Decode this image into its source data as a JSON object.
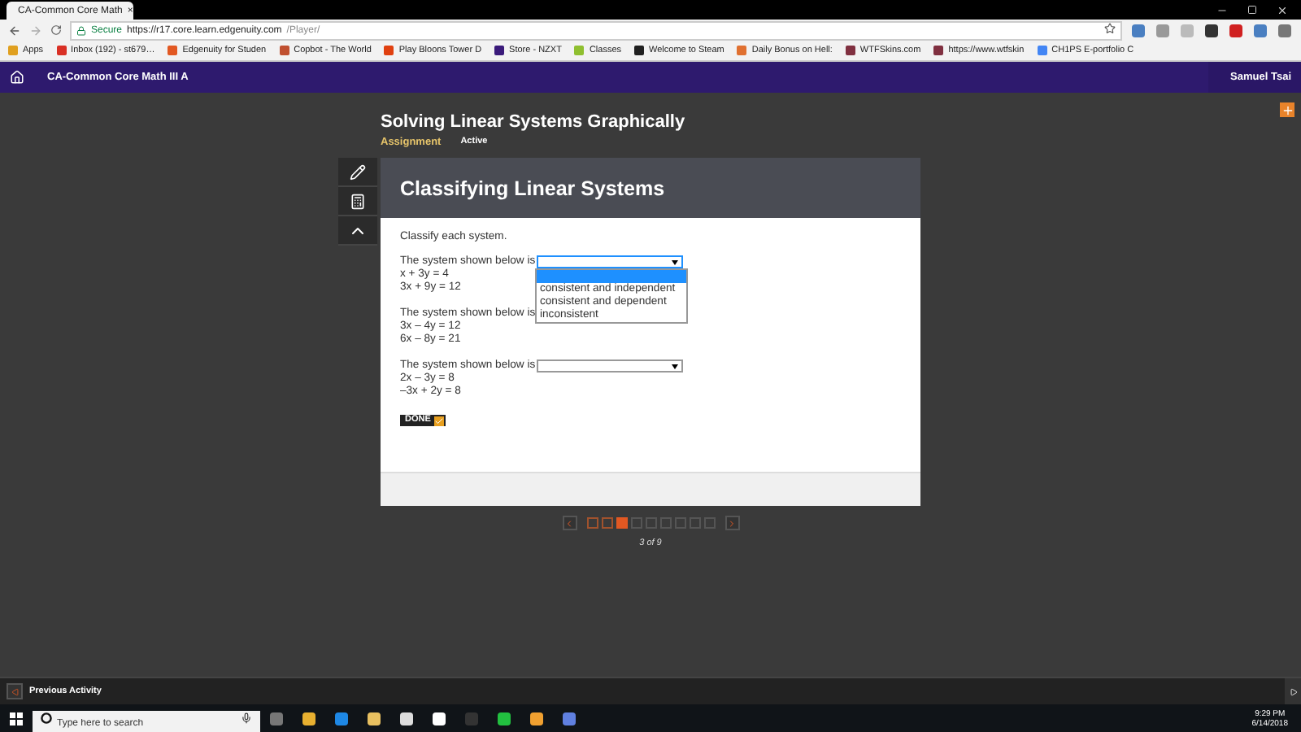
{
  "browser": {
    "tab_title": "CA-Common Core Math",
    "tab_close": "×",
    "secure_label": "Secure",
    "url_host": "https://r17.core.learn.edgenuity.com",
    "url_path": "/Player/",
    "bookmarks": [
      {
        "label": "Apps",
        "color": "#e0a020"
      },
      {
        "label": "Inbox (192) - st679…",
        "color": "#d93025"
      },
      {
        "label": "Edgenuity for Studen",
        "color": "#e25822"
      },
      {
        "label": "Copbot - The World",
        "color": "#c05030"
      },
      {
        "label": "Play Bloons Tower D",
        "color": "#e04010"
      },
      {
        "label": "Store - NZXT",
        "color": "#3a1a7a"
      },
      {
        "label": "Classes",
        "color": "#8fbf30"
      },
      {
        "label": "Welcome to Steam",
        "color": "#202020"
      },
      {
        "label": "Daily Bonus on Hell:",
        "color": "#e07030"
      },
      {
        "label": "WTFSkins.com",
        "color": "#803040"
      },
      {
        "label": "https://www.wtfskin",
        "color": "#803040"
      },
      {
        "label": "CH1PS E-portfolio C",
        "color": "#4285f4"
      }
    ]
  },
  "course_bar": {
    "title": "CA-Common Core Math III A",
    "user": "Samuel Tsai"
  },
  "lesson": {
    "title": "Solving Linear Systems Graphically",
    "tag": "Assignment",
    "status": "Active"
  },
  "activity": {
    "title": "Classifying Linear Systems",
    "instruction": "Classify each system.",
    "questions": [
      {
        "prompt": "The system shown below is",
        "equations": [
          "x + 3y = 4",
          "3x + 9y = 12"
        ],
        "expanded": true,
        "options": [
          {
            "selected": true
          },
          {
            "label": "consistent and independent",
            "selected": false
          },
          {
            "label": "consistent and dependent",
            "selected": false
          },
          {
            "label": "inconsistent",
            "selected": false
          }
        ]
      },
      {
        "prompt": "The system shown below is",
        "equations": [
          "3x – 4y = 12",
          "6x – 8y = 21"
        ]
      },
      {
        "prompt": "The system shown below is",
        "equations": [
          "2x – 3y = 8",
          "–3x + 2y = 8"
        ]
      }
    ],
    "done_label": "DONE"
  },
  "pager": {
    "pages": [
      {
        "visited": true,
        "selected": false
      },
      {
        "visited": true,
        "selected": false
      },
      {
        "visited": true,
        "selected": true
      },
      {
        "visited": false,
        "selected": false
      },
      {
        "visited": false,
        "selected": false
      },
      {
        "visited": false,
        "selected": false
      },
      {
        "visited": false,
        "selected": false
      },
      {
        "visited": false,
        "selected": false
      },
      {
        "visited": false,
        "selected": false
      }
    ],
    "reading": "3 of 9"
  },
  "footer": {
    "previous": "Previous Activity"
  },
  "taskbar": {
    "search_placeholder": "Type here to search",
    "time": "9:29 PM",
    "date": "6/14/2018"
  }
}
